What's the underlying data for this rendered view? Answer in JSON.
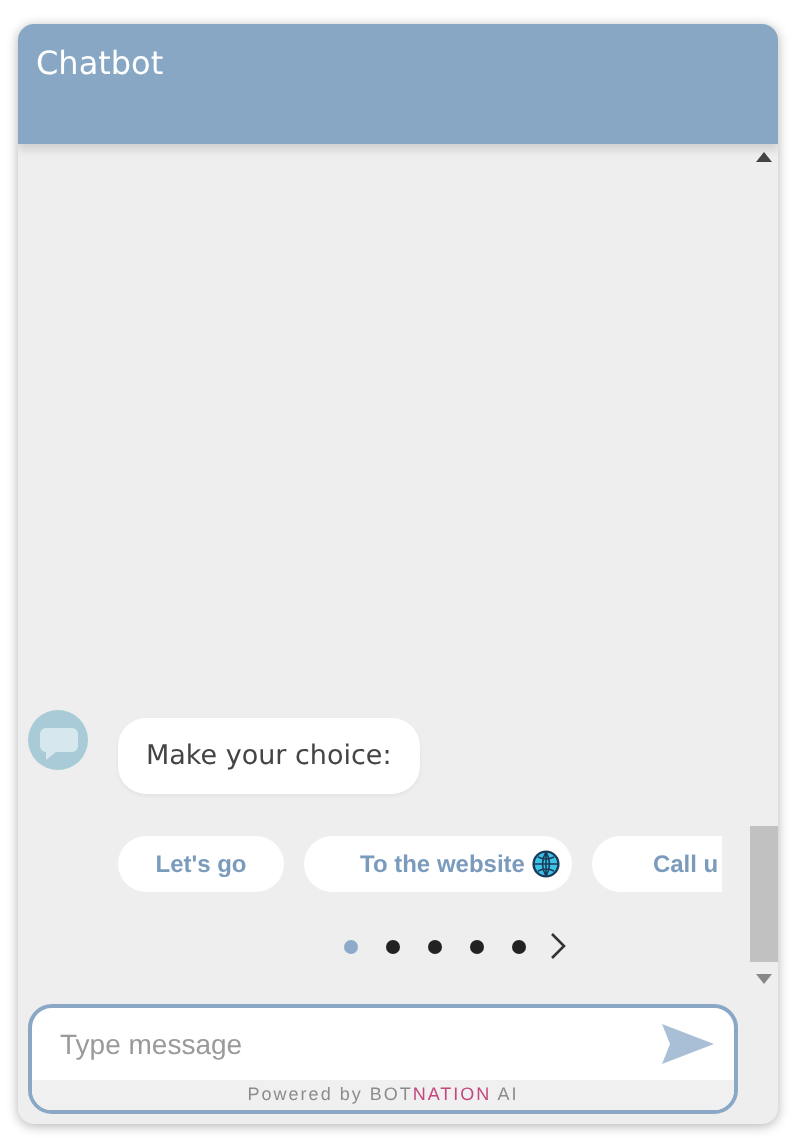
{
  "window": {
    "title": "Chatbot"
  },
  "messages": [
    {
      "text": "Make your choice:"
    }
  ],
  "choices": [
    {
      "label": "Let's go",
      "icon": false
    },
    {
      "label": "To the website",
      "icon": true
    },
    {
      "label": "Call u",
      "icon": false
    }
  ],
  "pager": {
    "dots": [
      {
        "selected": true
      },
      {
        "selected": false
      },
      {
        "selected": false
      },
      {
        "selected": false
      },
      {
        "selected": false
      }
    ]
  },
  "composer": {
    "placeholder": "Type message"
  },
  "footer": {
    "prefix": "Powered by",
    "brand": [
      {
        "text": "BOT",
        "color": "#8c8c8c"
      },
      {
        "text": "NATION",
        "color": "#c2487e"
      },
      {
        "text": " AI",
        "color": "#8c8c8c"
      }
    ]
  }
}
